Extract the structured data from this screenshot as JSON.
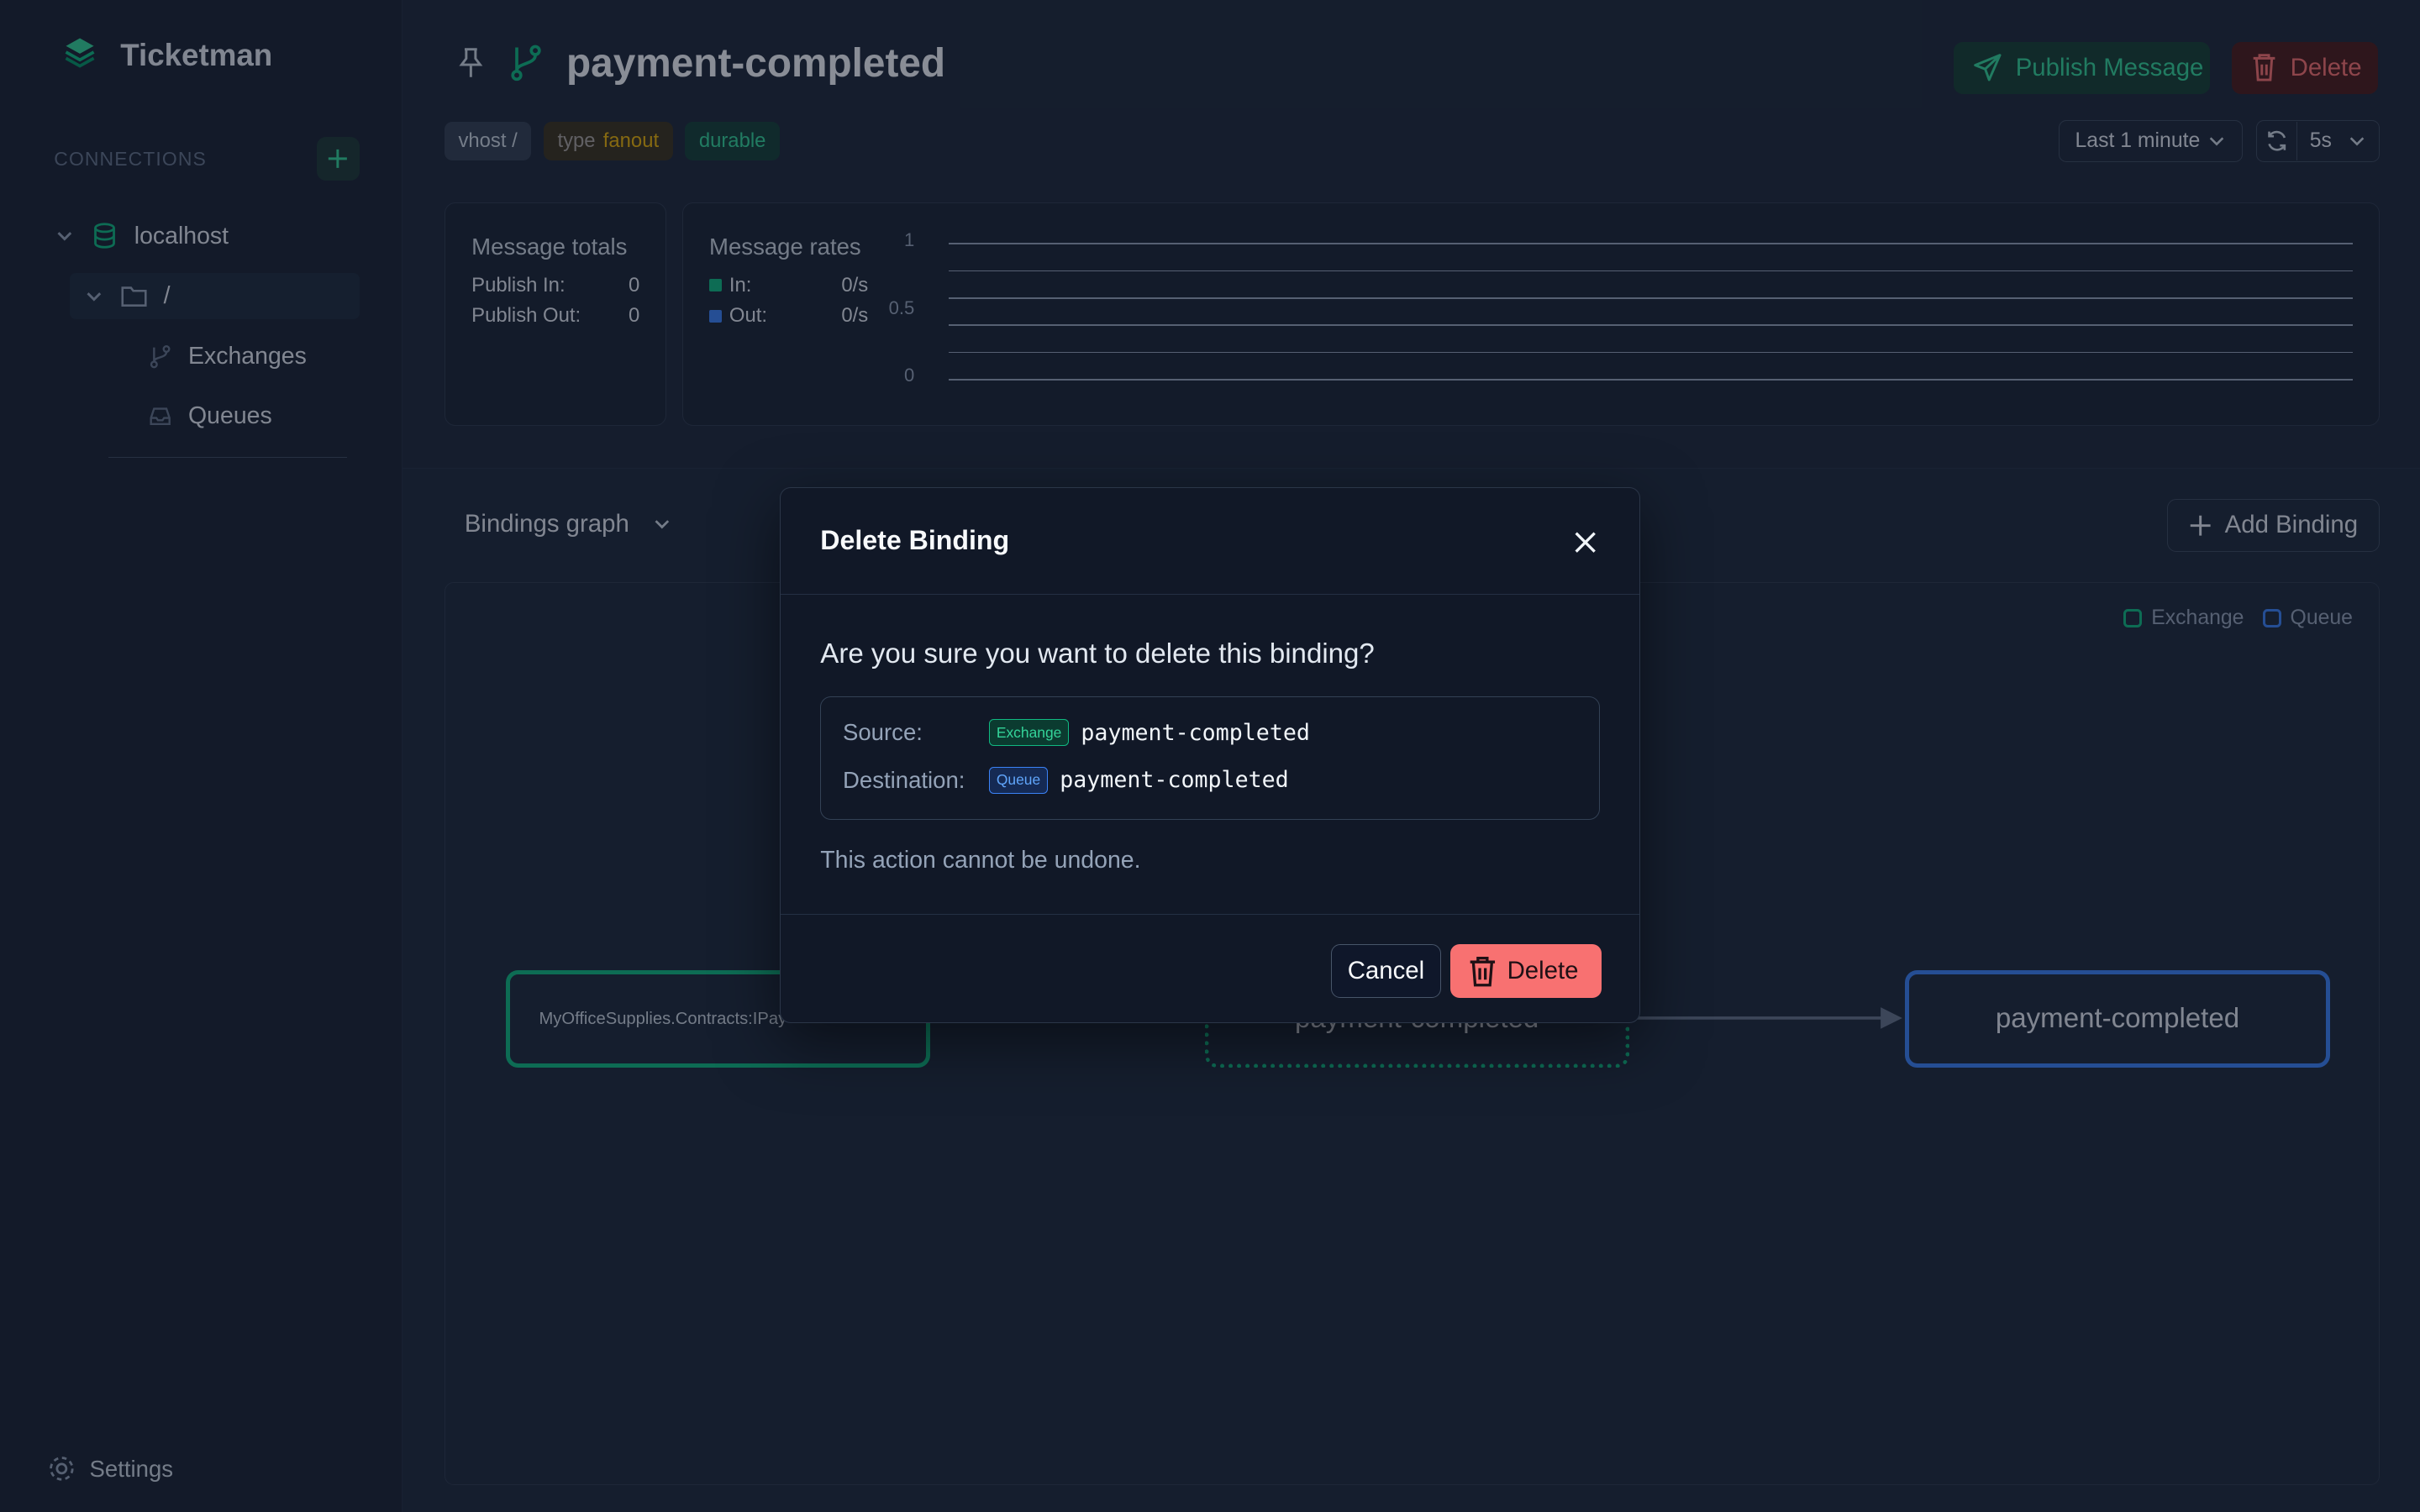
{
  "app": {
    "title": "Ticketman"
  },
  "sidebar": {
    "connections_label": "CONNECTIONS",
    "tree": {
      "host": "localhost",
      "vhost": "/",
      "exchanges": "Exchanges",
      "queues": "Queues"
    },
    "settings_label": "Settings"
  },
  "header": {
    "title": "payment-completed",
    "tags": {
      "vhost": "vhost /",
      "type_label": "type",
      "type_value": "fanout",
      "durable": "durable"
    },
    "publish_label": "Publish Message",
    "delete_label": "Delete",
    "time_range": "Last 1 minute",
    "refresh_interval": "5s"
  },
  "totals": {
    "heading": "Message totals",
    "publish_in_label": "Publish In:",
    "publish_in": "0",
    "publish_out_label": "Publish Out:",
    "publish_out": "0"
  },
  "rates": {
    "heading": "Message rates",
    "in_label": "In:",
    "in_value": "0/s",
    "out_label": "Out:",
    "out_value": "0/s",
    "in_color": "#10b981",
    "out_color": "#3b82f6"
  },
  "chart_data": {
    "type": "line",
    "title": "",
    "xlabel": "",
    "ylabel": "",
    "ylim": [
      0,
      1
    ],
    "yticks": [
      "1",
      "0.5",
      "0"
    ],
    "series": [
      {
        "name": "In",
        "values": []
      },
      {
        "name": "Out",
        "values": []
      }
    ],
    "grid": true
  },
  "bindings": {
    "view_label": "Bindings graph",
    "add_label": "Add Binding",
    "legend": {
      "exchange": "Exchange",
      "queue": "Queue"
    },
    "nodes": {
      "source": "MyOfficeSupplies.Contracts:IPay",
      "middle": "payment-completed",
      "queue": "payment-completed"
    }
  },
  "modal": {
    "title": "Delete Binding",
    "question": "Are you sure you want to delete this binding?",
    "source_label": "Source:",
    "source_badge": "Exchange",
    "source_name": "payment-completed",
    "dest_label": "Destination:",
    "dest_badge": "Queue",
    "dest_name": "payment-completed",
    "warning": "This action cannot be undone.",
    "cancel_label": "Cancel",
    "delete_label": "Delete"
  },
  "colors": {
    "accent": "#10b981",
    "queue": "#3b82f6",
    "danger": "#f87171",
    "background": "#1e293b"
  }
}
